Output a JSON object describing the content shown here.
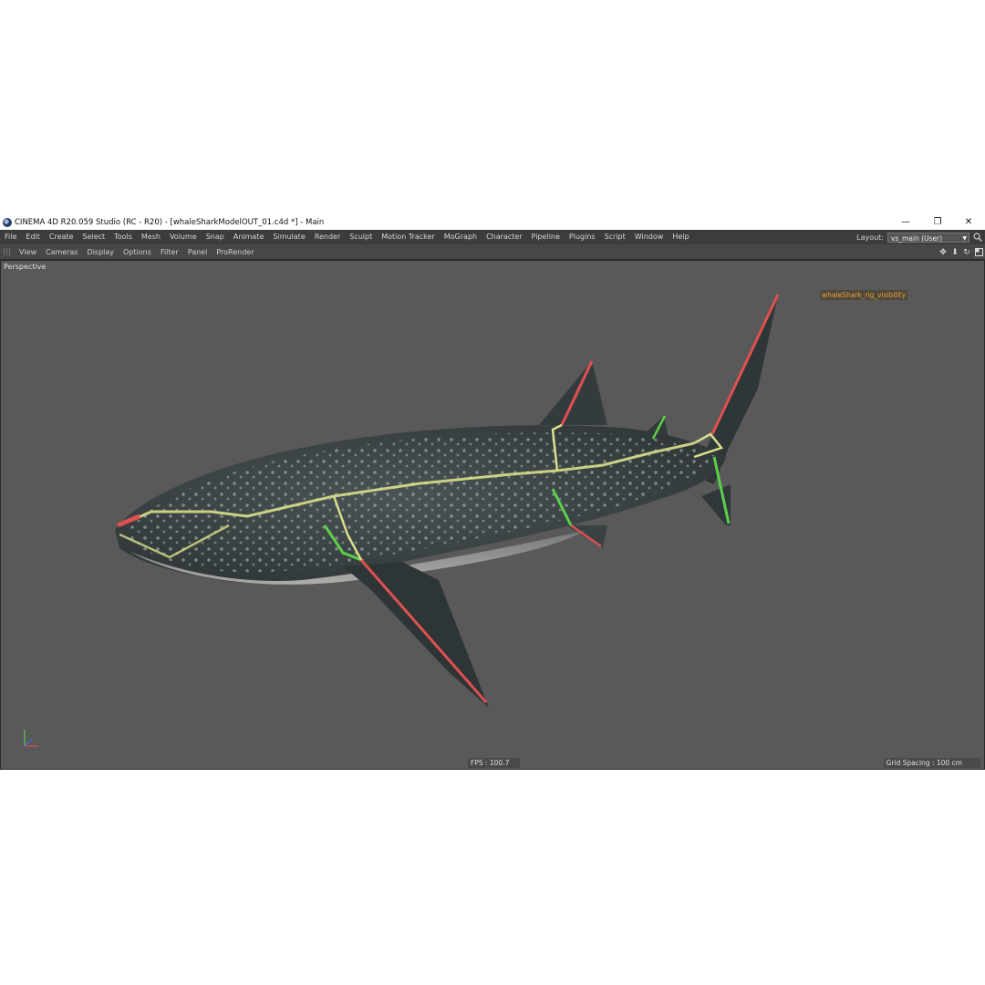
{
  "titlebar": {
    "title": "CINEMA 4D R20.059 Studio (RC - R20) - [whaleSharkModelOUT_01.c4d *] - Main",
    "minimize_glyph": "—",
    "maximize_glyph": "❐",
    "close_glyph": "✕"
  },
  "menubar": {
    "items": [
      "File",
      "Edit",
      "Create",
      "Select",
      "Tools",
      "Mesh",
      "Volume",
      "Snap",
      "Animate",
      "Simulate",
      "Render",
      "Sculpt",
      "Motion Tracker",
      "MoGraph",
      "Character",
      "Pipeline",
      "Plugins",
      "Script",
      "Window",
      "Help"
    ],
    "layout_label": "Layout:",
    "layout_value": "vs_main (User)"
  },
  "viewport_menu": {
    "items": [
      "View",
      "Cameras",
      "Display",
      "Options",
      "Filter",
      "Panel",
      "ProRender"
    ],
    "nav_icons": [
      "move-view-icon",
      "down-arrow-icon",
      "rotate-view-icon",
      "maximize-view-icon"
    ]
  },
  "viewport": {
    "camera": "Perspective",
    "rig_label": "whaleShark_rig_visibility",
    "fps": "FPS : 100.7",
    "grid_spacing": "Grid Spacing : 100 cm",
    "subject": "whale-shark-model"
  },
  "colors": {
    "viewport_bg": "#595959",
    "menubar_bg": "#3c3c3c",
    "joint_yellow": "#d8e08a",
    "joint_red": "#e05050",
    "joint_green": "#5ad04a",
    "label_orange": "#f0a030"
  }
}
